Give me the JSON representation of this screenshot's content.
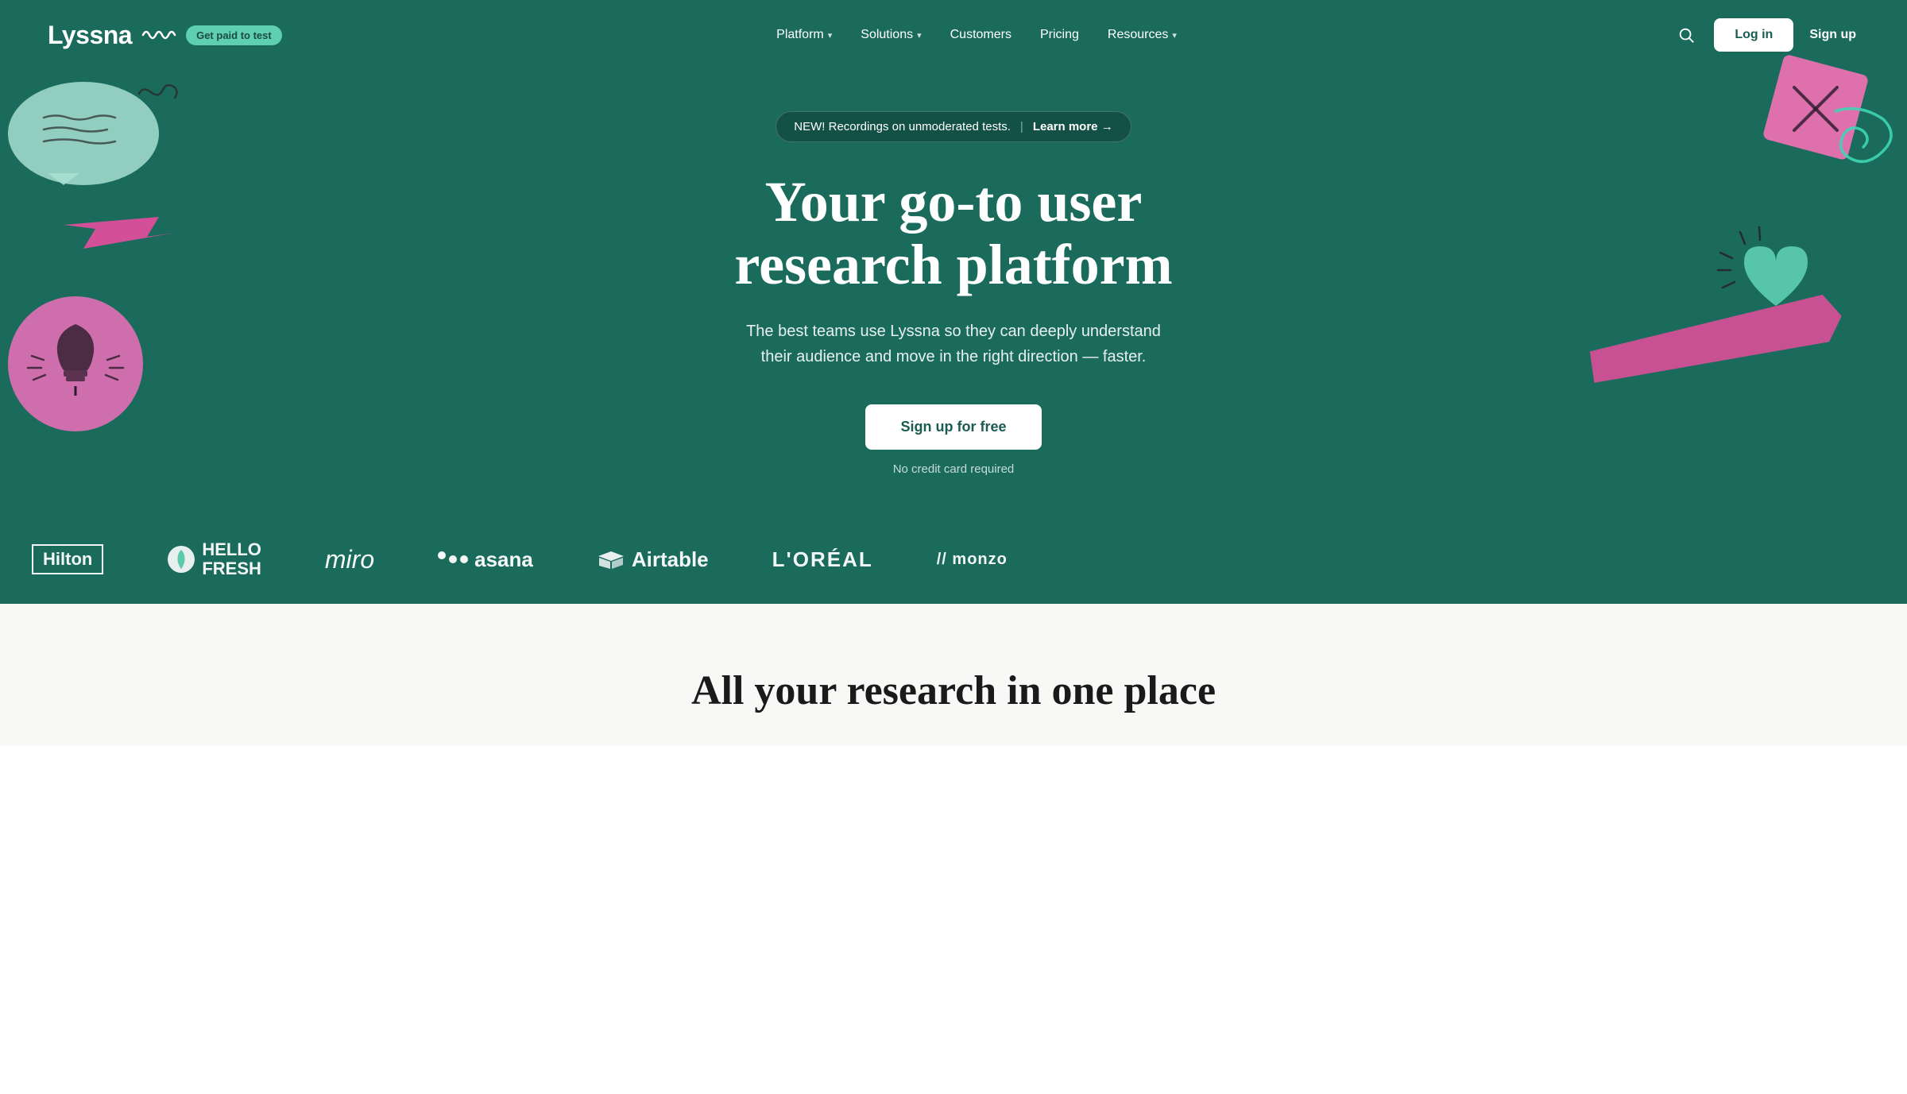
{
  "navbar": {
    "logo": "Lyssna",
    "logo_squiggles": "~~~",
    "badge_label": "Get paid to test",
    "nav_items": [
      {
        "label": "Platform",
        "has_dropdown": true
      },
      {
        "label": "Solutions",
        "has_dropdown": true
      },
      {
        "label": "Customers",
        "has_dropdown": false
      },
      {
        "label": "Pricing",
        "has_dropdown": false
      },
      {
        "label": "Resources",
        "has_dropdown": true
      }
    ],
    "login_label": "Log in",
    "signup_label": "Sign up"
  },
  "hero": {
    "announcement_text": "NEW! Recordings on unmoderated tests.",
    "announcement_divider": "|",
    "announcement_link": "Learn more →",
    "title_line1": "Your go-to user",
    "title_line2": "research platform",
    "subtitle": "The best teams use Lyssna so they can deeply understand their audience and move in the right direction — faster.",
    "cta_label": "Sign up for free",
    "no_cc_text": "No credit card required"
  },
  "logos": [
    {
      "name": "Hilton",
      "style": "hilton"
    },
    {
      "name": "HelloFresh",
      "style": "hellofresh"
    },
    {
      "name": "miro",
      "style": "miro"
    },
    {
      "name": "asana",
      "style": "asana"
    },
    {
      "name": "Airtable",
      "style": "airtable"
    },
    {
      "name": "L'ORÉAL",
      "style": "loreal"
    },
    {
      "name": "// monzo",
      "style": "monzo"
    }
  ],
  "section_below": {
    "title": "All your research in one place"
  },
  "colors": {
    "hero_bg": "#1a6b5c",
    "badge_bg": "#5ecfb1",
    "badge_text": "#1a4a42"
  }
}
